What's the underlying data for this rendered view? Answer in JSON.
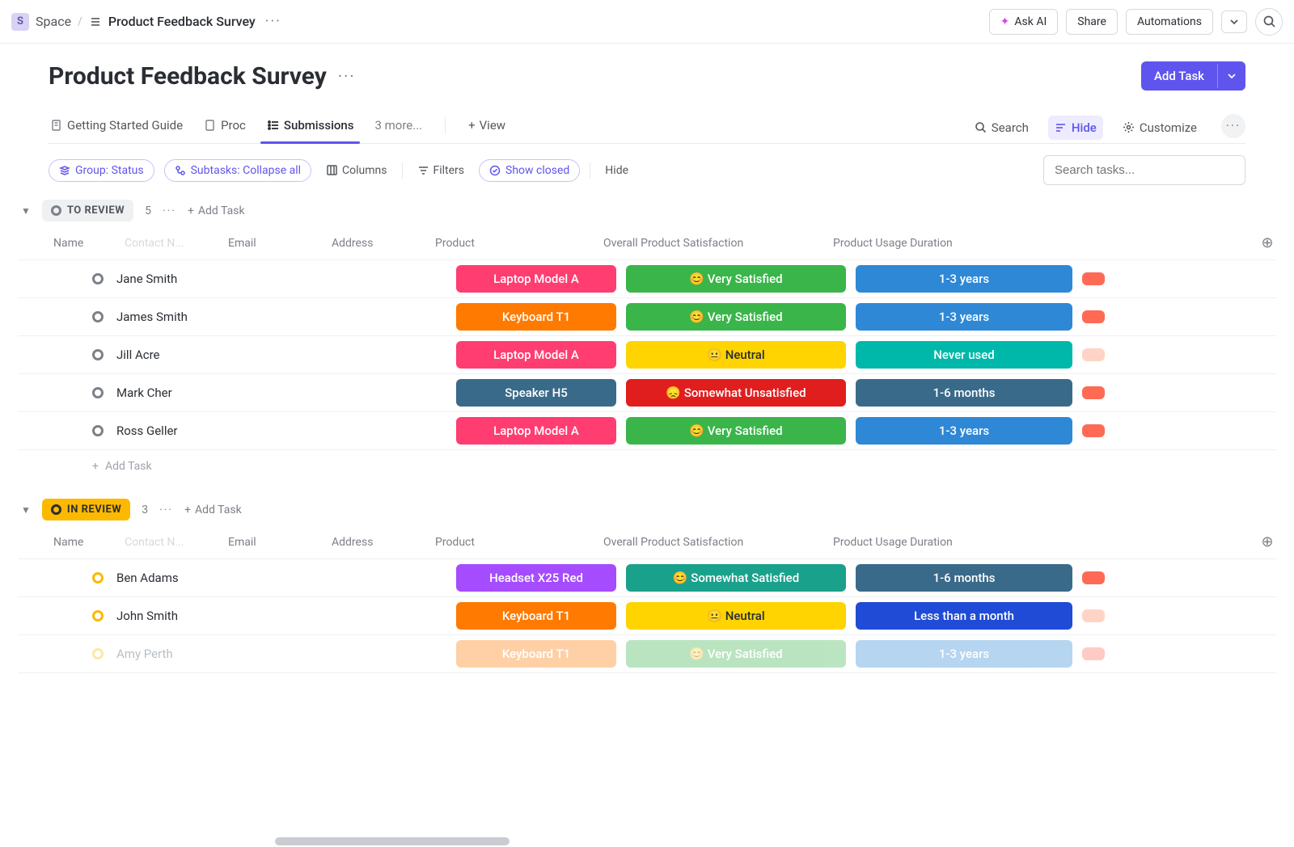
{
  "breadcrumb": {
    "space_letter": "S",
    "space": "Space",
    "title": "Product Feedback Survey"
  },
  "topbar": {
    "ask_ai": "Ask AI",
    "share": "Share",
    "automations": "Automations"
  },
  "header": {
    "title": "Product Feedback Survey",
    "add_task": "Add Task"
  },
  "tabs": {
    "getting_started": "Getting Started Guide",
    "proc": "Proc",
    "submissions": "Submissions",
    "more": "3 more...",
    "view": "View"
  },
  "toolbar": {
    "search": "Search",
    "hide": "Hide",
    "customize": "Customize"
  },
  "chips": {
    "group": "Group: Status",
    "subtasks": "Subtasks: Collapse all",
    "columns": "Columns",
    "filters": "Filters",
    "show_closed": "Show closed",
    "hide_btn": "Hide",
    "search_placeholder": "Search tasks..."
  },
  "columns": {
    "name": "Name",
    "contact": "Contact N...",
    "email": "Email",
    "address": "Address",
    "product": "Product",
    "satisfaction": "Overall Product Satisfaction",
    "duration": "Product Usage Duration"
  },
  "groups": [
    {
      "status": "TO REVIEW",
      "count": "5",
      "add": "Add Task",
      "footer_add": "Add Task",
      "rows": [
        {
          "name": "Jane Smith",
          "product": {
            "t": "Laptop Model A",
            "c": "pink"
          },
          "sat": {
            "t": "😊 Very Satisfied",
            "c": "green"
          },
          "dur": {
            "t": "1-3 years",
            "c": "blue"
          },
          "extra": "coral"
        },
        {
          "name": "James Smith",
          "product": {
            "t": "Keyboard T1",
            "c": "orange"
          },
          "sat": {
            "t": "😊 Very Satisfied",
            "c": "green"
          },
          "dur": {
            "t": "1-3 years",
            "c": "blue"
          },
          "extra": "coral"
        },
        {
          "name": "Jill Acre",
          "product": {
            "t": "Laptop Model A",
            "c": "pink"
          },
          "sat": {
            "t": "😐 Neutral",
            "c": "lime"
          },
          "dur": {
            "t": "Never used",
            "c": "teal"
          },
          "extra": "coral-light"
        },
        {
          "name": "Mark Cher",
          "product": {
            "t": "Speaker H5",
            "c": "steel"
          },
          "sat": {
            "t": "😞 Somewhat Unsatisfied",
            "c": "red"
          },
          "dur": {
            "t": "1-6 months",
            "c": "steel"
          },
          "extra": "coral"
        },
        {
          "name": "Ross Geller",
          "product": {
            "t": "Laptop Model A",
            "c": "pink"
          },
          "sat": {
            "t": "😊 Very Satisfied",
            "c": "green"
          },
          "dur": {
            "t": "1-3 years",
            "c": "blue"
          },
          "extra": "coral"
        }
      ]
    },
    {
      "status": "IN REVIEW",
      "count": "3",
      "add": "Add Task",
      "rows": [
        {
          "name": "Ben Adams",
          "product": {
            "t": "Headset X25 Red",
            "c": "purple"
          },
          "sat": {
            "t": "😊 Somewhat Satisfied",
            "c": "emerald"
          },
          "dur": {
            "t": "1-6 months",
            "c": "steel"
          },
          "extra": "coral"
        },
        {
          "name": "John Smith",
          "product": {
            "t": "Keyboard T1",
            "c": "orange"
          },
          "sat": {
            "t": "😐 Neutral",
            "c": "lime"
          },
          "dur": {
            "t": "Less than a month",
            "c": "indigo"
          },
          "extra": "coral-light"
        },
        {
          "name": "Amy Perth",
          "product": {
            "t": "Keyboard T1",
            "c": "orange"
          },
          "sat": {
            "t": "😊 Very Satisfied",
            "c": "green"
          },
          "dur": {
            "t": "1-3 years",
            "c": "blue"
          },
          "extra": "coral",
          "faded": true
        }
      ]
    }
  ]
}
